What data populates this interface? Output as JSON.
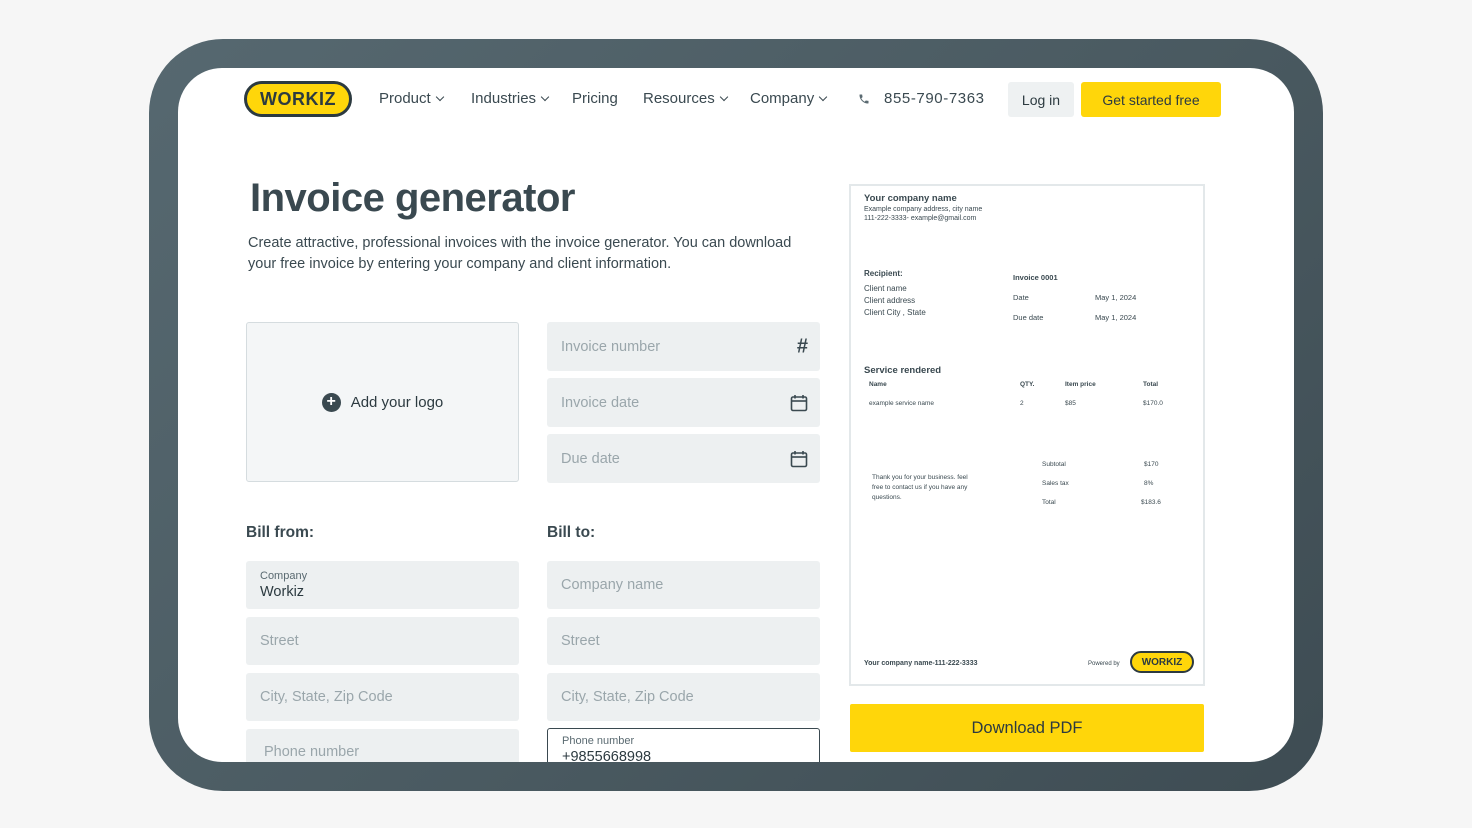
{
  "nav": {
    "logo": "WORKIZ",
    "items": [
      {
        "label": "Product",
        "dropdown": true
      },
      {
        "label": "Industries",
        "dropdown": true
      },
      {
        "label": "Pricing",
        "dropdown": false
      },
      {
        "label": "Resources",
        "dropdown": true
      },
      {
        "label": "Company",
        "dropdown": true
      }
    ],
    "phone": "855-790-7363",
    "login": "Log in",
    "get_started": "Get started free"
  },
  "hero": {
    "title": "Invoice generator",
    "subtitle": "Create attractive, professional invoices with the invoice generator. You can download your free invoice by entering your company and client information."
  },
  "form": {
    "add_logo": "Add your logo",
    "invoice_number_placeholder": "Invoice number",
    "invoice_date_placeholder": "Invoice date",
    "due_date_placeholder": "Due date",
    "bill_from_label": "Bill from:",
    "bill_to_label": "Bill to:",
    "bill_from": {
      "company_label": "Company",
      "company_value": "Workiz",
      "street_placeholder": "Street",
      "city_placeholder": "City, State, Zip Code",
      "phone_placeholder": "Phone number"
    },
    "bill_to": {
      "company_placeholder": "Company name",
      "street_placeholder": "Street",
      "city_placeholder": "City, State, Zip Code",
      "phone_label": "Phone number",
      "phone_value": "+9855668998"
    }
  },
  "preview": {
    "company_name": "Your company name",
    "company_address": "Example company address, city name",
    "company_contact": "111-222-3333- example@gmail.com",
    "recipient_label": "Recipient:",
    "client_name": "Client name",
    "client_address": "Client address",
    "client_city": "Client City , State",
    "invoice_no": "Invoice 0001",
    "date_label": "Date",
    "date_value": "May 1, 2024",
    "due_label": "Due date",
    "due_value": "May 1, 2024",
    "service_title": "Service rendered",
    "col_name": "Name",
    "col_qty": "QTY.",
    "col_price": "Item price",
    "col_total": "Total",
    "row_name": "example service name",
    "row_qty": "2",
    "row_price": "$85",
    "row_total": "$170.0",
    "thanks_1": "Thank you for your business. feel",
    "thanks_2": "free to contact us if you have any",
    "thanks_3": "questions.",
    "subtotal_label": "Subtotal",
    "subtotal_value": "$170",
    "tax_label": "Sales tax",
    "tax_value": "8%",
    "total_label": "Total",
    "total_value": "$183.6",
    "footer_company": "Your company name-111-222-3333",
    "powered_by": "Powered by",
    "footer_logo": "WORKIZ"
  },
  "download": "Download PDF"
}
